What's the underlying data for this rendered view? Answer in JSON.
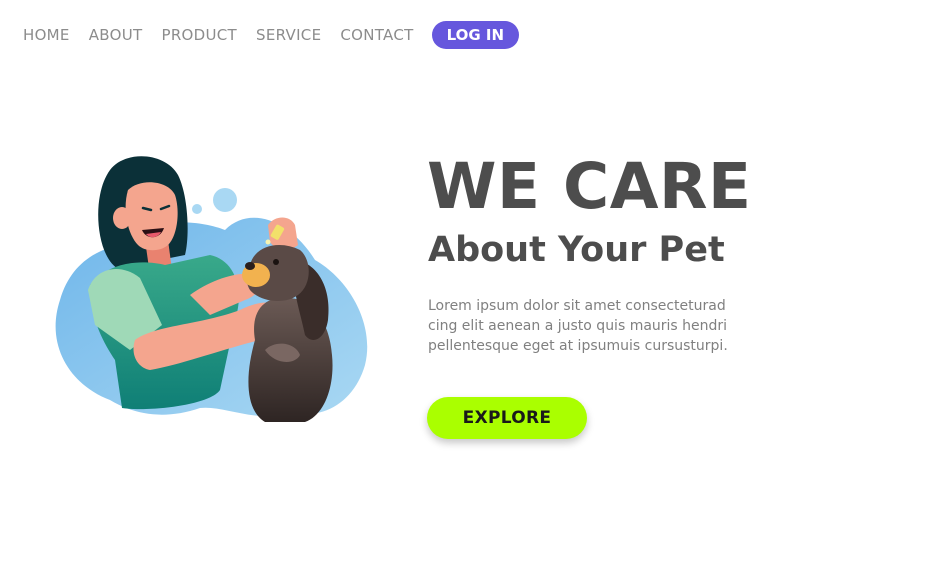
{
  "nav": {
    "links": [
      "HOME",
      "ABOUT",
      "PRODUCT",
      "SERVICE",
      "CONTACT"
    ],
    "login_label": "LOG IN"
  },
  "hero": {
    "title": "WE CARE",
    "subtitle": "About Your Pet",
    "text_lines": [
      "Lorem ipsum dolor sit amet consecteturad",
      "cing elit aenean a justo quis mauris hendri",
      "pellentesque eget at ipsumuis cursusturpi."
    ],
    "cta_label": "EXPLORE"
  },
  "colors": {
    "login_bg": "#6657dd",
    "cta_bg": "#aaff00",
    "heading": "#4d4d4d",
    "nav_text": "#8c8c8c"
  },
  "illustration": {
    "name": "woman-applying-drops-to-dog"
  }
}
